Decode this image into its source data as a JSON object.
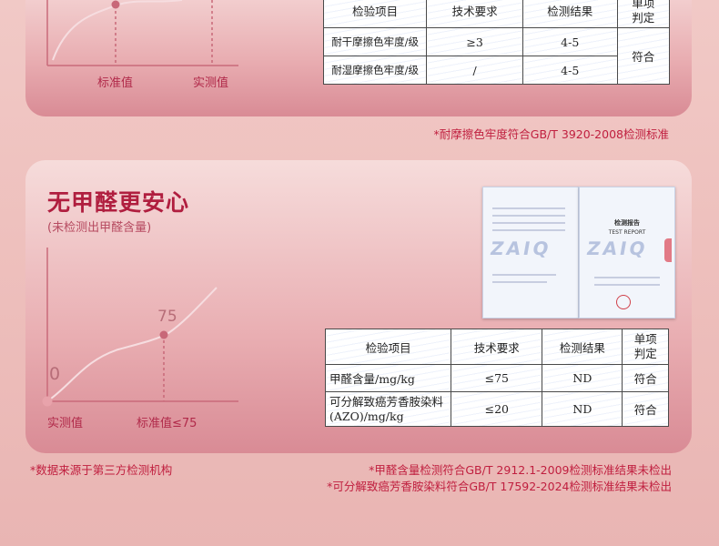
{
  "section1": {
    "axis_labels": [
      "标准值",
      "实测值"
    ],
    "table": {
      "headers": [
        "检验项目",
        "技术要求",
        "检测结果",
        "单项\n判定"
      ],
      "rows": [
        {
          "item": "耐干摩擦色牢度/级",
          "requirement": "≥3",
          "result": "4-5"
        },
        {
          "item": "耐湿摩擦色牢度/级",
          "requirement": "/",
          "result": "4-5"
        }
      ],
      "verdict": "符合"
    },
    "note": "*耐摩擦色牢度符合GB/T 3920-2008检测标准"
  },
  "section2": {
    "title": "无甲醛更安心",
    "subtitle": "(未检测出甲醛含量)",
    "chart_data": {
      "type": "line",
      "categories": [
        "实测值",
        "标准值≤75"
      ],
      "values": [
        0,
        75
      ],
      "value_labels": [
        "0",
        "75"
      ]
    },
    "certificate": {
      "watermark": "ZAIQ",
      "title_cn": "检测报告",
      "title_en": "TEST REPORT"
    },
    "table": {
      "headers": [
        "检验项目",
        "技术要求",
        "检测结果",
        "单项\n判定"
      ],
      "rows": [
        {
          "item": "甲醛含量/mg/kg",
          "requirement": "≤75",
          "result": "ND",
          "verdict": "符合"
        },
        {
          "item": "可分解致癌芳香胺染料(AZO)/mg/kg",
          "requirement": "≤20",
          "result": "ND",
          "verdict": "符合"
        }
      ]
    },
    "note_left": "*数据来源于第三方检测机构",
    "notes_right": [
      "*甲醛含量检测符合GB/T 2912.1-2009检测标准结果未检出",
      "*可分解致癌芳香胺染料符合GB/T 17592-2024检测标准结果未检出"
    ]
  },
  "colors": {
    "accent": "#b01e3f",
    "curve": "#f6dde0",
    "dot": "#c86878"
  }
}
